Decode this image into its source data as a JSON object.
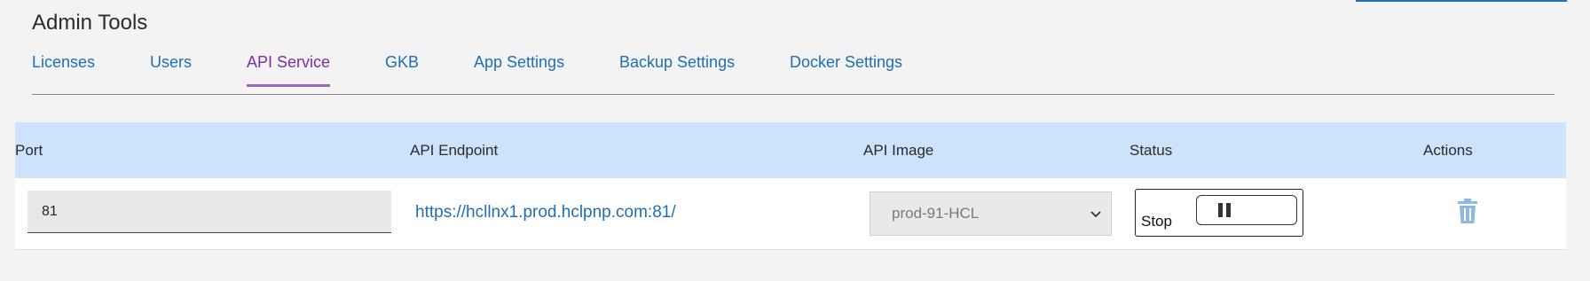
{
  "header": {
    "title": "Admin Tools"
  },
  "tabs": [
    {
      "label": "Licenses"
    },
    {
      "label": "Users"
    },
    {
      "label": "API Service",
      "active": true
    },
    {
      "label": "GKB"
    },
    {
      "label": "App Settings"
    },
    {
      "label": "Backup Settings"
    },
    {
      "label": "Docker Settings"
    }
  ],
  "table": {
    "columns": [
      "Port",
      "API Endpoint",
      "API Image",
      "Status",
      "Actions"
    ],
    "rows": [
      {
        "port": "81",
        "endpoint": "https://hcllnx1.prod.hclpnp.com:81/",
        "image": "prod-91-HCL",
        "status": "Stop"
      }
    ]
  },
  "icons": {
    "pause": "pause-icon",
    "delete": "trash-icon",
    "select": "chevron-down-icon"
  },
  "colors": {
    "link": "#1f6fb2",
    "active_tab": "#7b2fa0",
    "header_bg": "#cce3fb",
    "delete_icon": "#8fb8e0"
  }
}
